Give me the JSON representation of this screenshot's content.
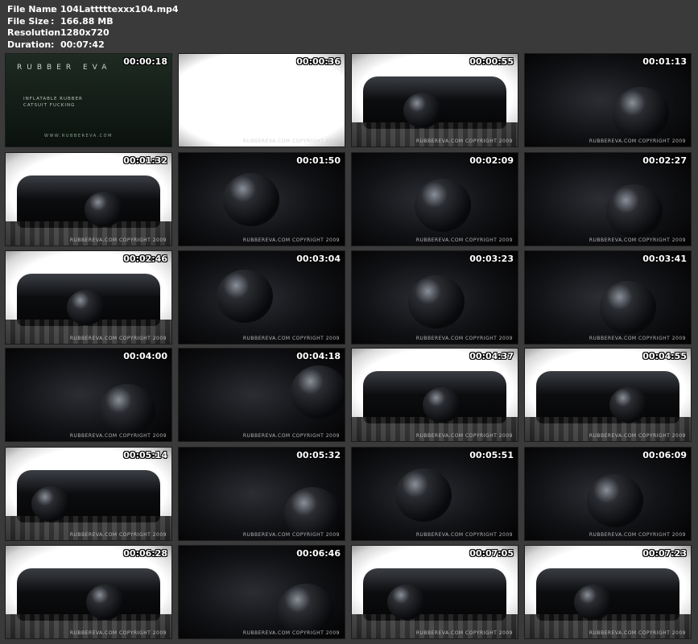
{
  "file_info": {
    "rows": [
      {
        "label": "File Name",
        "sep": ":",
        "value": "104Latttttexxx104.mp4"
      },
      {
        "label": "File Size",
        "sep": ":",
        "value": "166.88 MB"
      },
      {
        "label": "Resolution",
        "sep": ":",
        "value": "1280x720"
      },
      {
        "label": "Duration",
        "sep": ":",
        "value": "00:07:42"
      }
    ]
  },
  "thumbnails": [
    {
      "time": "00:00:18",
      "style": "green",
      "logo": "RUBBER EVA",
      "subtitle": "INFLATABLE RUBBER\nCATSUIT FUCKING",
      "site": "WWW.RUBBEREVA.COM"
    },
    {
      "time": "00:00:36",
      "style": "white",
      "watermark": "RUBBEREVA.COM COPYRIGHT 2009"
    },
    {
      "time": "00:00:55",
      "style": "light",
      "watermark": "RUBBEREVA.COM COPYRIGHT 2009"
    },
    {
      "time": "00:01:13",
      "style": "dark",
      "watermark": "RUBBEREVA.COM COPYRIGHT 2009"
    },
    {
      "time": "00:01:32",
      "style": "light",
      "watermark": "RUBBEREVA.COM COPYRIGHT 2009"
    },
    {
      "time": "00:01:50",
      "style": "dark",
      "watermark": "RUBBEREVA.COM COPYRIGHT 2009"
    },
    {
      "time": "00:02:09",
      "style": "dark",
      "watermark": "RUBBEREVA.COM COPYRIGHT 2009"
    },
    {
      "time": "00:02:27",
      "style": "dark",
      "watermark": "RUBBEREVA.COM COPYRIGHT 2009"
    },
    {
      "time": "00:02:46",
      "style": "light",
      "watermark": "RUBBEREVA.COM COPYRIGHT 2009"
    },
    {
      "time": "00:03:04",
      "style": "dark",
      "watermark": "RUBBEREVA.COM COPYRIGHT 2009"
    },
    {
      "time": "00:03:23",
      "style": "dark",
      "watermark": "RUBBEREVA.COM COPYRIGHT 2009"
    },
    {
      "time": "00:03:41",
      "style": "dark",
      "watermark": "RUBBEREVA.COM COPYRIGHT 2009"
    },
    {
      "time": "00:04:00",
      "style": "dark",
      "watermark": "RUBBEREVA.COM COPYRIGHT 2009"
    },
    {
      "time": "00:04:18",
      "style": "dark",
      "watermark": "RUBBEREVA.COM COPYRIGHT 2009"
    },
    {
      "time": "00:04:37",
      "style": "light",
      "watermark": "RUBBEREVA.COM COPYRIGHT 2009"
    },
    {
      "time": "00:04:55",
      "style": "light",
      "watermark": "RUBBEREVA.COM COPYRIGHT 2009"
    },
    {
      "time": "00:05:14",
      "style": "light",
      "watermark": "RUBBEREVA.COM COPYRIGHT 2009"
    },
    {
      "time": "00:05:32",
      "style": "dark",
      "watermark": "RUBBEREVA.COM COPYRIGHT 2009"
    },
    {
      "time": "00:05:51",
      "style": "dark",
      "watermark": "RUBBEREVA.COM COPYRIGHT 2009"
    },
    {
      "time": "00:06:09",
      "style": "dark",
      "watermark": "RUBBEREVA.COM COPYRIGHT 2009"
    },
    {
      "time": "00:06:28",
      "style": "light",
      "watermark": "RUBBEREVA.COM COPYRIGHT 2009"
    },
    {
      "time": "00:06:46",
      "style": "dark",
      "watermark": "RUBBEREVA.COM COPYRIGHT 2009"
    },
    {
      "time": "00:07:05",
      "style": "light",
      "watermark": "RUBBEREVA.COM COPYRIGHT 2009"
    },
    {
      "time": "00:07:23",
      "style": "light",
      "watermark": "RUBBEREVA.COM COPYRIGHT 2009"
    }
  ]
}
